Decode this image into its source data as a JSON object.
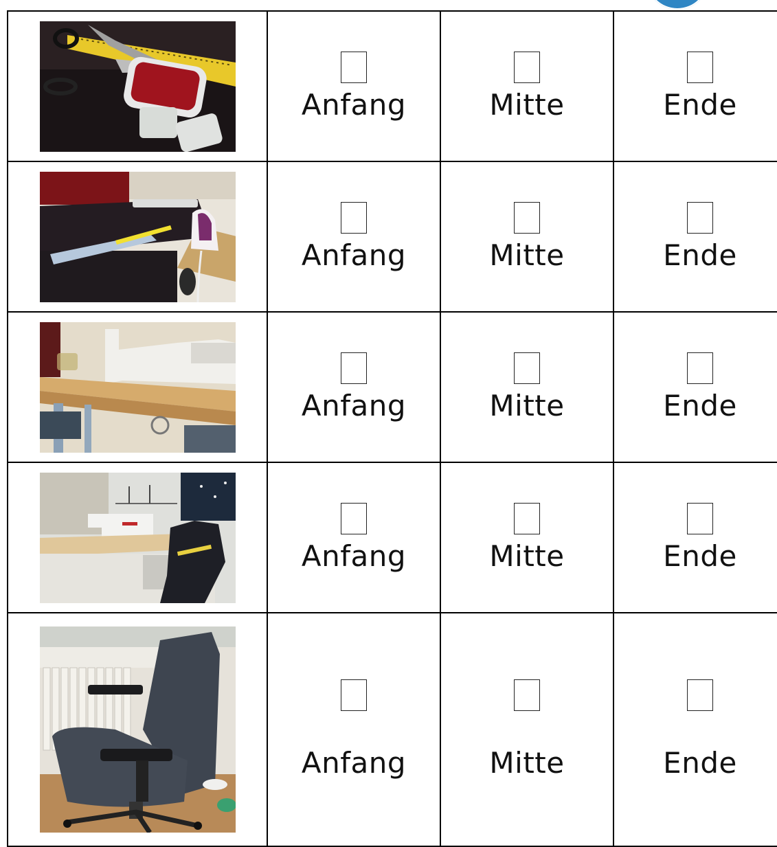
{
  "rows": [
    {
      "image": "scissors-ruler-lint-brush-photo",
      "options": [
        "Anfang",
        "Mitte",
        "Ende"
      ]
    },
    {
      "image": "ironing-table-photo",
      "options": [
        "Anfang",
        "Mitte",
        "Ende"
      ]
    },
    {
      "image": "sewing-machine-table-photo",
      "options": [
        "Anfang",
        "Mitte",
        "Ende"
      ]
    },
    {
      "image": "industrial-sewing-machine-photo",
      "options": [
        "Anfang",
        "Mitte",
        "Ende"
      ]
    },
    {
      "image": "office-chair-photo",
      "options": [
        "Anfang",
        "Mitte",
        "Ende"
      ]
    }
  ],
  "colors": {
    "logo": "#2f86c4",
    "border": "#000000"
  }
}
